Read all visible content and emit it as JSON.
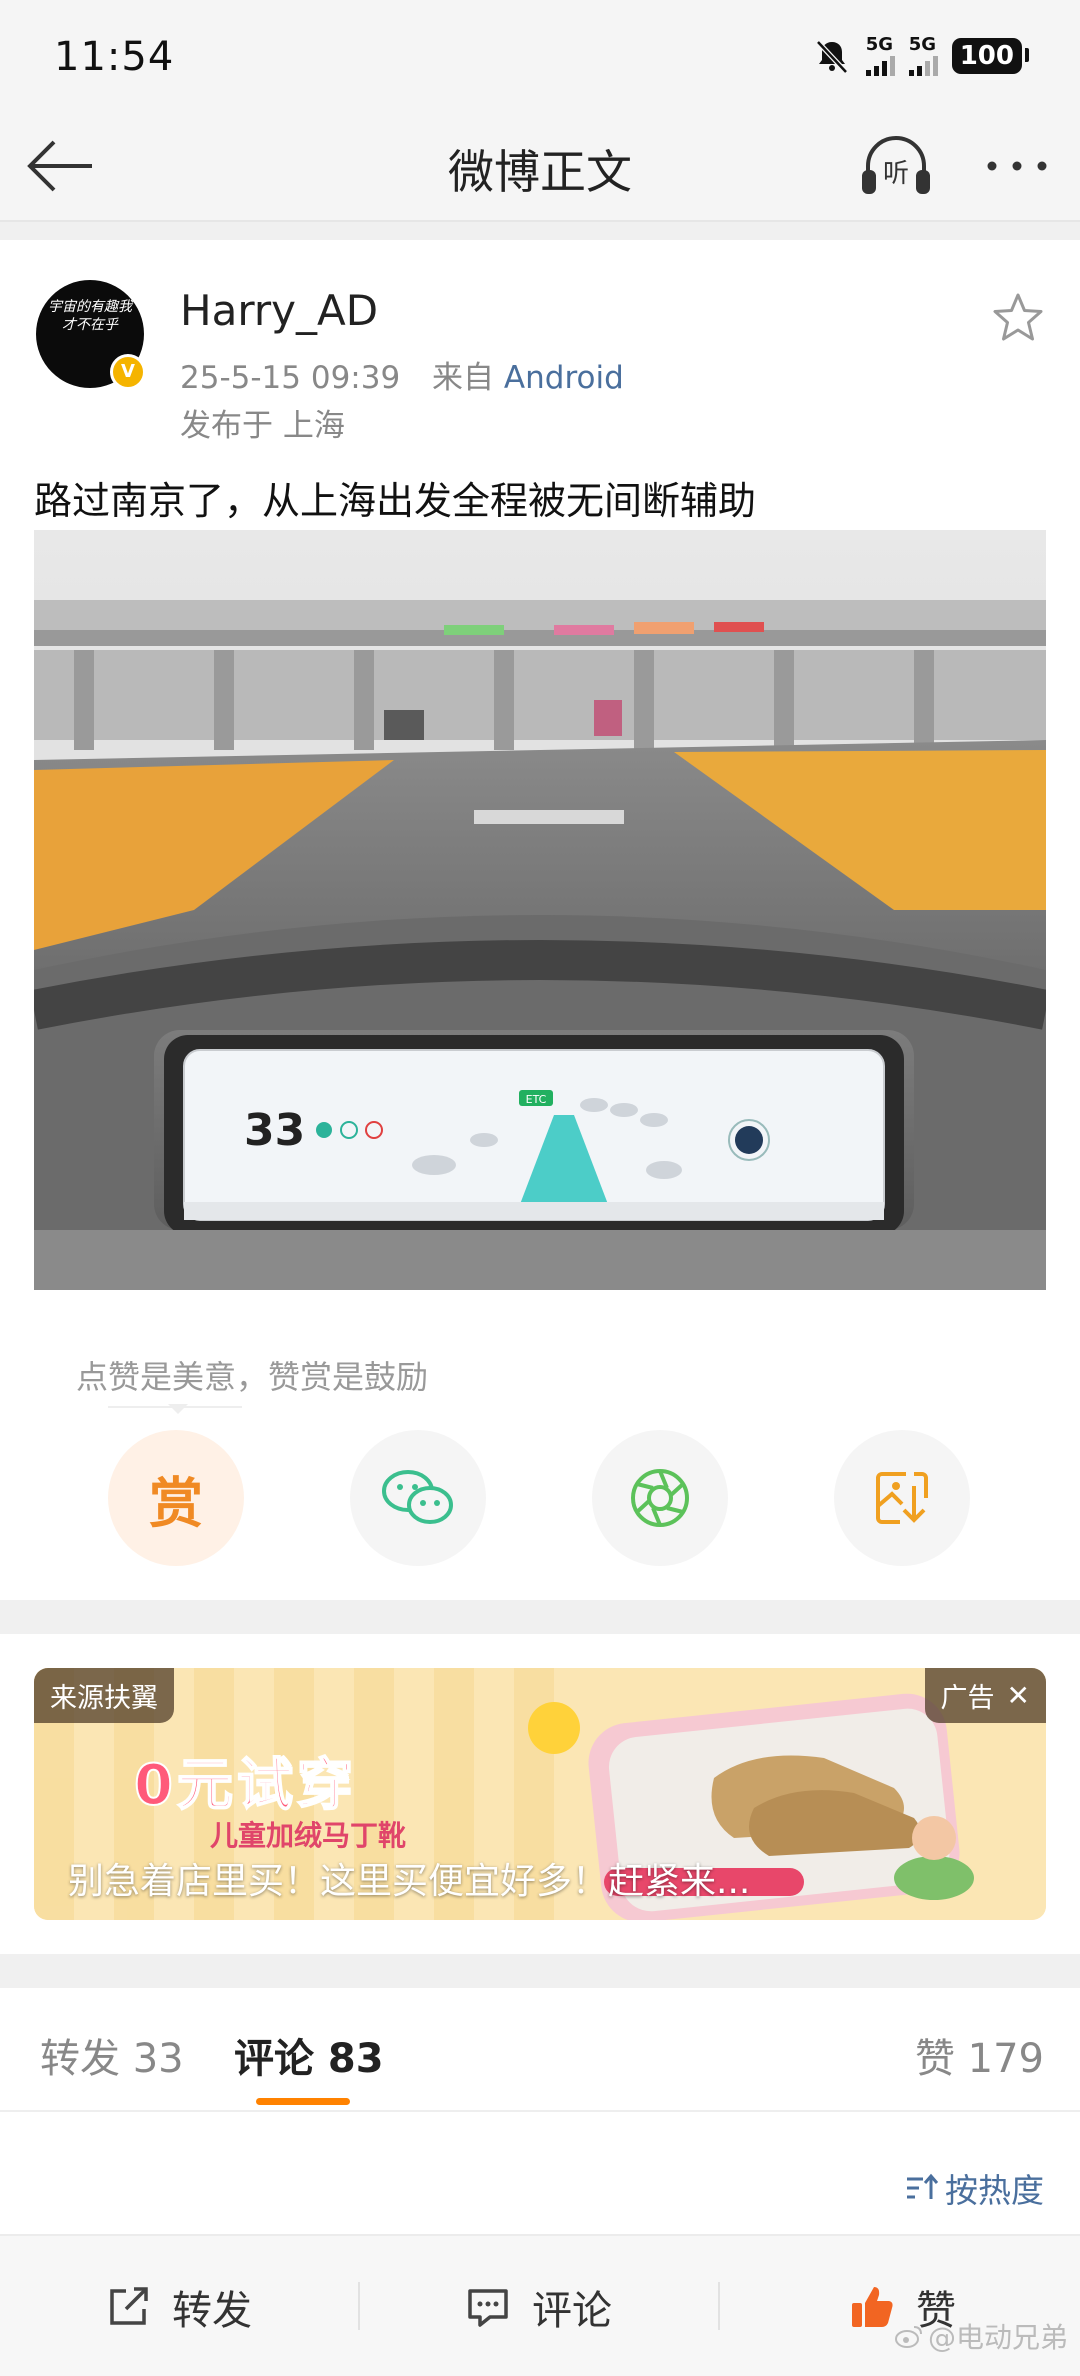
{
  "status_bar": {
    "time": "11:54",
    "network_1": "5G",
    "network_2": "5G",
    "battery": "100"
  },
  "nav": {
    "title": "微博正文",
    "listen_label": "听"
  },
  "post": {
    "username": "Harry_AD",
    "date": "25-5-15 09:39",
    "source_prefix": "来自",
    "source": "Android",
    "location": "发布于 上海",
    "text": "路过南京了，从上海出发全程被无间断辅助",
    "verified_mark": "V",
    "avatar_text": "宇宙的有趣我才不在乎"
  },
  "dashboard": {
    "speed": "33",
    "etc_tag": "ETC"
  },
  "actions": {
    "hint": "点赞是美意，赞赏是鼓励",
    "reward_label": "赏"
  },
  "ad": {
    "source_label": "来源扶翼",
    "ad_label": "广告",
    "close_symbol": "✕",
    "headline": "0元试穿",
    "subline": "儿童加绒马丁靴",
    "caption": "别急着店里买！这里买便宜好多！赶紧来..."
  },
  "tabs": {
    "repost": "转发 33",
    "comments": "评论 83",
    "likes": "赞 179"
  },
  "sort": {
    "label": "按热度"
  },
  "bottom_bar": {
    "repost": "转发",
    "comment": "评论",
    "like": "赞"
  },
  "watermark": "@电动兄弟",
  "colors": {
    "accent_orange": "#ff8200",
    "link_blue": "#4a6f9d",
    "reward_orange": "#f08a24",
    "like_orange": "#f26522"
  }
}
